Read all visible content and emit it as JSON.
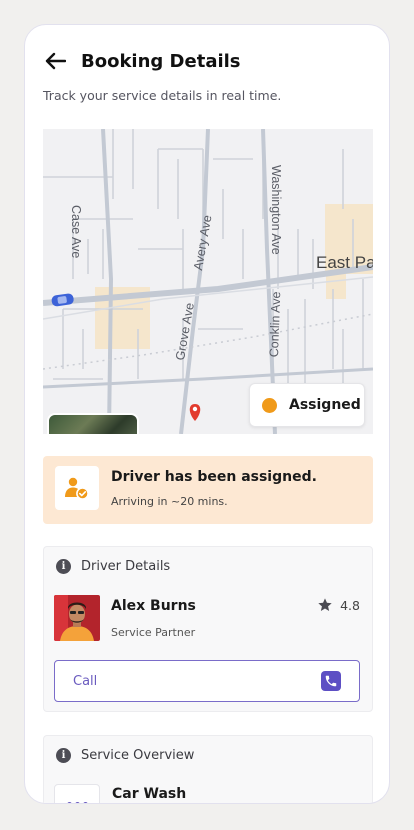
{
  "header": {
    "title": "Booking Details",
    "subtitle": "Track your service details in real time."
  },
  "map": {
    "streets": [
      "Case Ave",
      "Avery Ave",
      "Washington Ave",
      "Grove Ave",
      "Conklin Ave"
    ],
    "area_label": "East Pa",
    "status_label": "Assigned",
    "status_color": "#f09a1a"
  },
  "notice": {
    "title": "Driver has been assigned.",
    "subtitle": "Arriving in ~20 mins."
  },
  "driver_card": {
    "section_title": "Driver Details",
    "name": "Alex Burns",
    "role": "Service Partner",
    "rating": "4.8",
    "call_label": "Call"
  },
  "service_card": {
    "section_title": "Service Overview",
    "service_name": "Car Wash"
  },
  "colors": {
    "accent": "#6a5bbf",
    "notice_bg": "#fde8d3",
    "status": "#f09a1a"
  }
}
